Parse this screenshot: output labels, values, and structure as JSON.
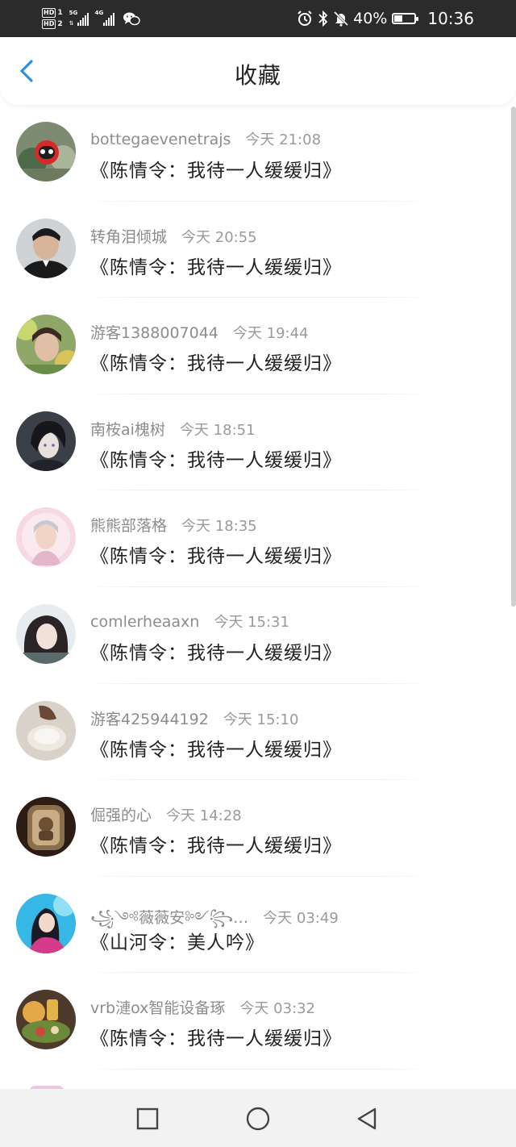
{
  "status_bar": {
    "hd1": "HD",
    "hd1_num": "1",
    "hd2": "HD",
    "hd2_num": "2",
    "sig1_label": "5G",
    "sig2_label": "4G",
    "battery": "40%",
    "time": "10:36",
    "battery_level": 0.4
  },
  "header": {
    "title": "收藏",
    "accent": "#2f8fdf"
  },
  "items": [
    {
      "user": "bottegaevenetrajs",
      "time": "今天 21:08",
      "song": "《陈情令：我待一人缓缓归》"
    },
    {
      "user": "转角泪倾城",
      "time": "今天 20:55",
      "song": "《陈情令：我待一人缓缓归》"
    },
    {
      "user": "游客1388007044",
      "time": "今天 19:44",
      "song": "《陈情令：我待一人缓缓归》"
    },
    {
      "user": "南桉ai槐树",
      "time": "今天 18:51",
      "song": "《陈情令：我待一人缓缓归》"
    },
    {
      "user": "熊熊部落格",
      "time": "今天 18:35",
      "song": "《陈情令：我待一人缓缓归》"
    },
    {
      "user": "comlerheaaxn",
      "time": "今天 15:31",
      "song": "《陈情令：我待一人缓缓归》"
    },
    {
      "user": "游客425944192",
      "time": "今天 15:10",
      "song": "《陈情令：我待一人缓缓归》"
    },
    {
      "user": "倔强的心",
      "time": "今天 14:28",
      "song": "《陈情令：我待一人缓缓归》"
    },
    {
      "user": "꧁༺薇薇安༻꧂…",
      "time": "今天 03:49",
      "song": "《山河令：美人吟》"
    },
    {
      "user": "vrb漣ox智能设备琢",
      "time": "今天 03:32",
      "song": "《陈情令：我待一人缓缓归》"
    }
  ]
}
